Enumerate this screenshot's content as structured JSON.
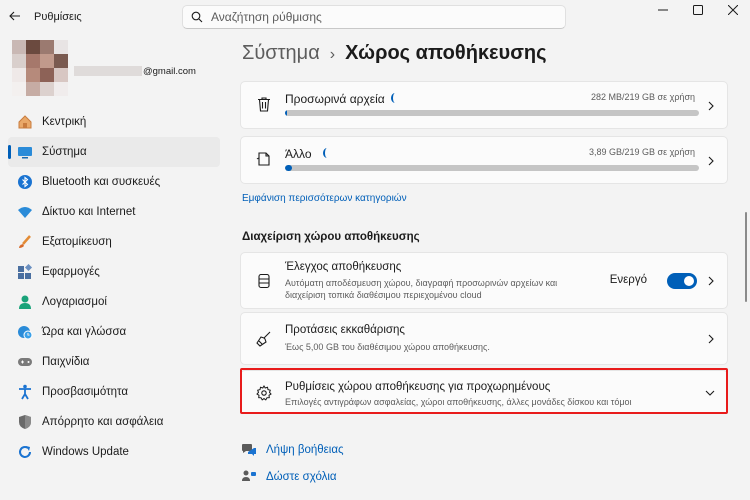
{
  "window": {
    "title": "Ρυθμίσεις",
    "search_placeholder": "Αναζήτηση ρύθμισης"
  },
  "profile": {
    "email_suffix": "@gmail.com"
  },
  "sidebar": {
    "items": [
      {
        "label": "Κεντρική",
        "icon": "home-icon"
      },
      {
        "label": "Σύστημα",
        "icon": "system-icon",
        "active": true
      },
      {
        "label": "Bluetooth και συσκευές",
        "icon": "bluetooth-icon"
      },
      {
        "label": "Δίκτυο και Internet",
        "icon": "wifi-icon"
      },
      {
        "label": "Εξατομίκευση",
        "icon": "brush-icon"
      },
      {
        "label": "Εφαρμογές",
        "icon": "apps-icon"
      },
      {
        "label": "Λογαριασμοί",
        "icon": "account-icon"
      },
      {
        "label": "Ώρα και γλώσσα",
        "icon": "globe-clock-icon"
      },
      {
        "label": "Παιχνίδια",
        "icon": "gamepad-icon"
      },
      {
        "label": "Προσβασιμότητα",
        "icon": "accessibility-icon"
      },
      {
        "label": "Απόρρητο και ασφάλεια",
        "icon": "shield-icon"
      },
      {
        "label": "Windows Update",
        "icon": "update-icon"
      }
    ]
  },
  "breadcrumb": {
    "root": "Σύστημα",
    "separator": "›",
    "current": "Χώρος αποθήκευσης"
  },
  "storage": {
    "temp": {
      "label": "Προσωρινά αρχεία",
      "size": "282 MB/219 GB σε χρήση",
      "fraction": 0.0013
    },
    "other": {
      "label": "Άλλο",
      "size": "3,89 GB/219 GB σε χρήση",
      "fraction": 0.018
    }
  },
  "more_categories": "Εμφάνιση περισσότερων κατηγοριών",
  "management": {
    "title": "Διαχείριση χώρου αποθήκευσης",
    "sense": {
      "title": "Έλεγχος αποθήκευσης",
      "desc1": "Αυτόματη αποδέσμευση χώρου, διαγραφή προσωρινών αρχείων και",
      "desc2": "διαχείριση τοπικά διαθέσιμου περιεχομένου cloud",
      "state": "Ενεργό",
      "on": true
    },
    "cleanup": {
      "title": "Προτάσεις εκκαθάρισης",
      "desc": "Έως 5,00 GB του διαθέσιμου χώρου αποθήκευσης."
    },
    "advanced": {
      "title": "Ρυθμίσεις χώρου αποθήκευσης για προχωρημένους",
      "desc": "Επιλογές αντιγράφων ασφαλείας, χώροι αποθήκευσης, άλλες μονάδες δίσκου και τόμοι"
    }
  },
  "footer": {
    "help": "Λήψη βοήθειας",
    "feedback": "Δώστε σχόλια"
  },
  "colors": {
    "accent": "#005fb8",
    "highlight": "#e81b1b"
  }
}
